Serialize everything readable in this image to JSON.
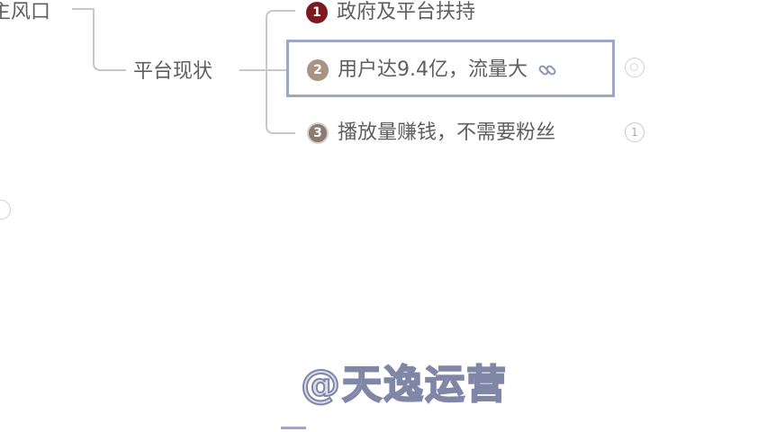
{
  "mindmap": {
    "parent_left": {
      "label": "主风口"
    },
    "parent_mid": {
      "label": "平台现状"
    },
    "children": [
      {
        "index": "1",
        "label": "政府及平台扶持"
      },
      {
        "index": "2",
        "label": "用户达9.4亿，流量大"
      },
      {
        "index": "3",
        "label": "播放量赚钱，不需要粉丝"
      }
    ],
    "count_badge": "1"
  },
  "watermark": {
    "text": "@天逸运营"
  },
  "colors": {
    "badge_1": "#7b1a1f",
    "badge_2": "#a89384",
    "badge_3": "#8a7a70",
    "selection_border": "#9ea7c4",
    "line": "#c8c8c8",
    "text": "#5f5f5f"
  },
  "icons": {
    "link": "link-icon",
    "summary_circle": "circle-icon"
  }
}
